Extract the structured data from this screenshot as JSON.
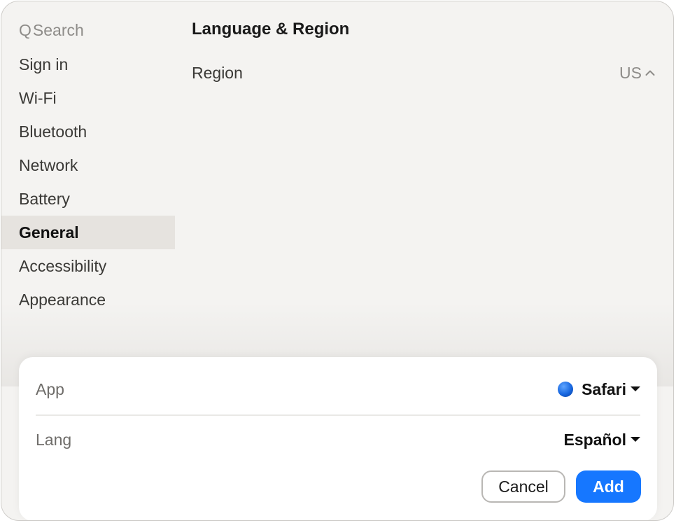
{
  "sidebar": {
    "search": {
      "icon": "search-icon",
      "glyph": "Q",
      "placeholder": "Search"
    },
    "items": [
      {
        "label": "Sign in"
      },
      {
        "label": "Wi-Fi"
      },
      {
        "label": "Bluetooth"
      },
      {
        "label": "Network"
      },
      {
        "label": "Battery"
      },
      {
        "label": "General",
        "selected": true
      },
      {
        "label": "Accessibility"
      },
      {
        "label": "Appearance"
      }
    ]
  },
  "main": {
    "title": "Language & Region",
    "region": {
      "label": "Region",
      "value": "US",
      "icon": "chevron-up-icon"
    }
  },
  "sheet": {
    "app": {
      "label": "App",
      "value": "Safari",
      "icon": "safari-app-icon",
      "caret": "caret-down-icon"
    },
    "lang": {
      "label": "Lang",
      "value": "Español",
      "caret": "caret-down-icon"
    },
    "cancel_label": "Cancel",
    "add_label": "Add"
  },
  "colors": {
    "accent": "#1677ff",
    "window_bg": "#f4f3f1",
    "selected_bg": "#e6e3df",
    "sheet_bg": "#ffffff"
  }
}
